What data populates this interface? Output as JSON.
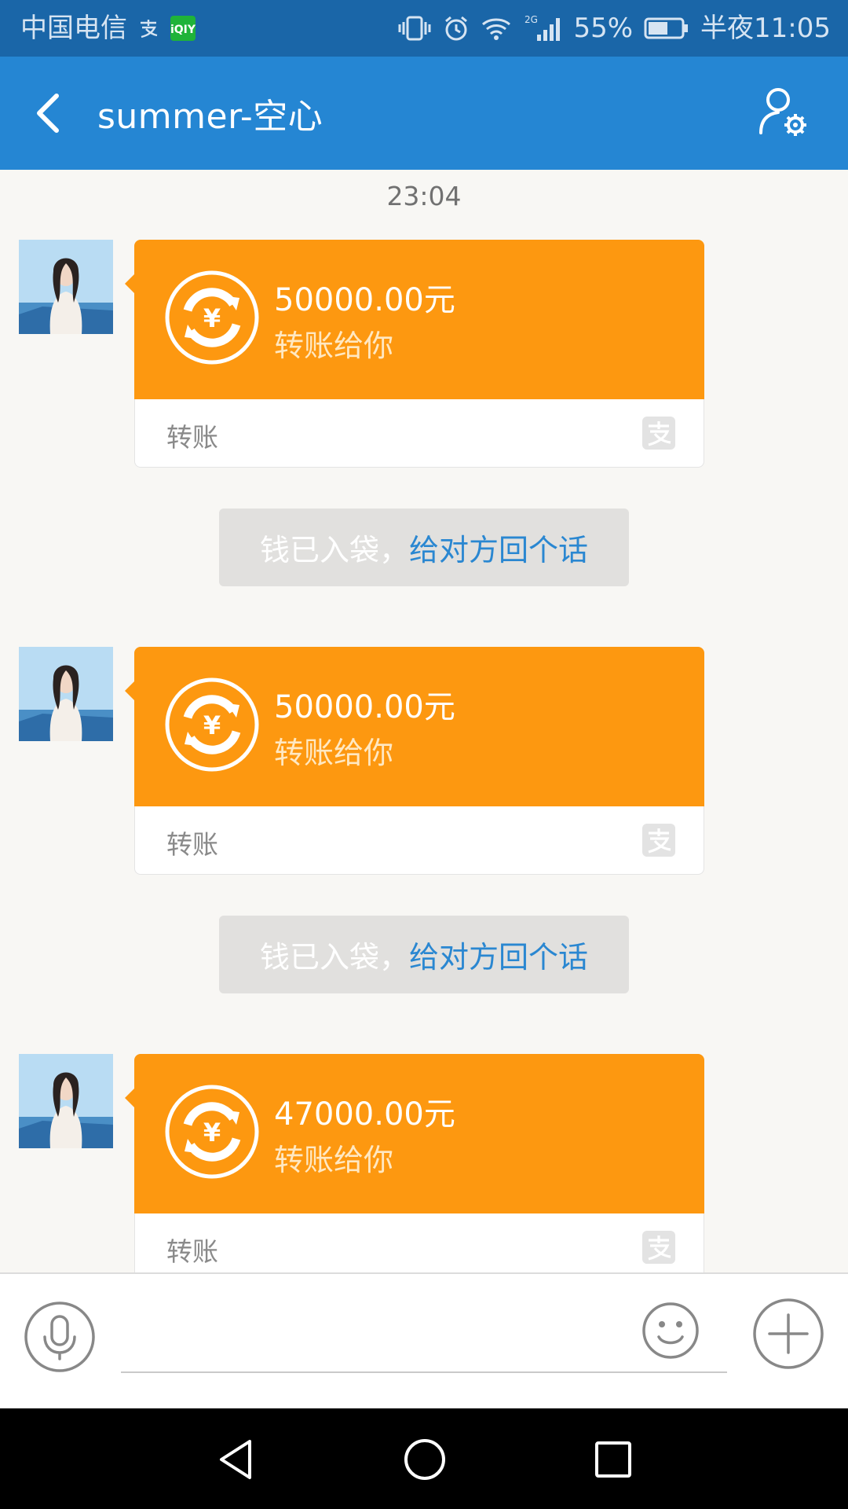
{
  "status_bar": {
    "carrier": "中国电信",
    "battery_percent": "55%",
    "time": "半夜11:05",
    "signal_tag": "2G",
    "icons": [
      "alipay-notification-icon",
      "iqiyi-icon",
      "vibrate-icon",
      "alarm-icon",
      "wifi-icon",
      "signal-icon",
      "battery-icon"
    ]
  },
  "header": {
    "title": "summer-空心",
    "back_icon": "chevron-left-icon",
    "profile_icon": "user-settings-icon"
  },
  "chat": {
    "timestamp": "23:04",
    "messages": [
      {
        "type": "transfer",
        "amount": "50000.00元",
        "description": "转账给你",
        "label": "转账"
      },
      {
        "type": "notice",
        "text": "钱已入袋，",
        "link": "给对方回个话"
      },
      {
        "type": "transfer",
        "amount": "50000.00元",
        "description": "转账给你",
        "label": "转账"
      },
      {
        "type": "notice",
        "text": "钱已入袋，",
        "link": "给对方回个话"
      },
      {
        "type": "transfer",
        "amount": "47000.00元",
        "description": "转账给你",
        "label": "转账"
      }
    ]
  },
  "input_bar": {
    "placeholder": "",
    "icons": [
      "microphone-icon",
      "emoji-icon",
      "plus-icon"
    ]
  },
  "nav_bar": {
    "icons": [
      "nav-back-icon",
      "nav-home-icon",
      "nav-recent-icon"
    ]
  },
  "colors": {
    "status_bar": "#1a66a8",
    "header": "#2586d3",
    "transfer_orange": "#fd9810",
    "link_blue": "#2a87d1",
    "notice_bg": "#e1e0de"
  }
}
